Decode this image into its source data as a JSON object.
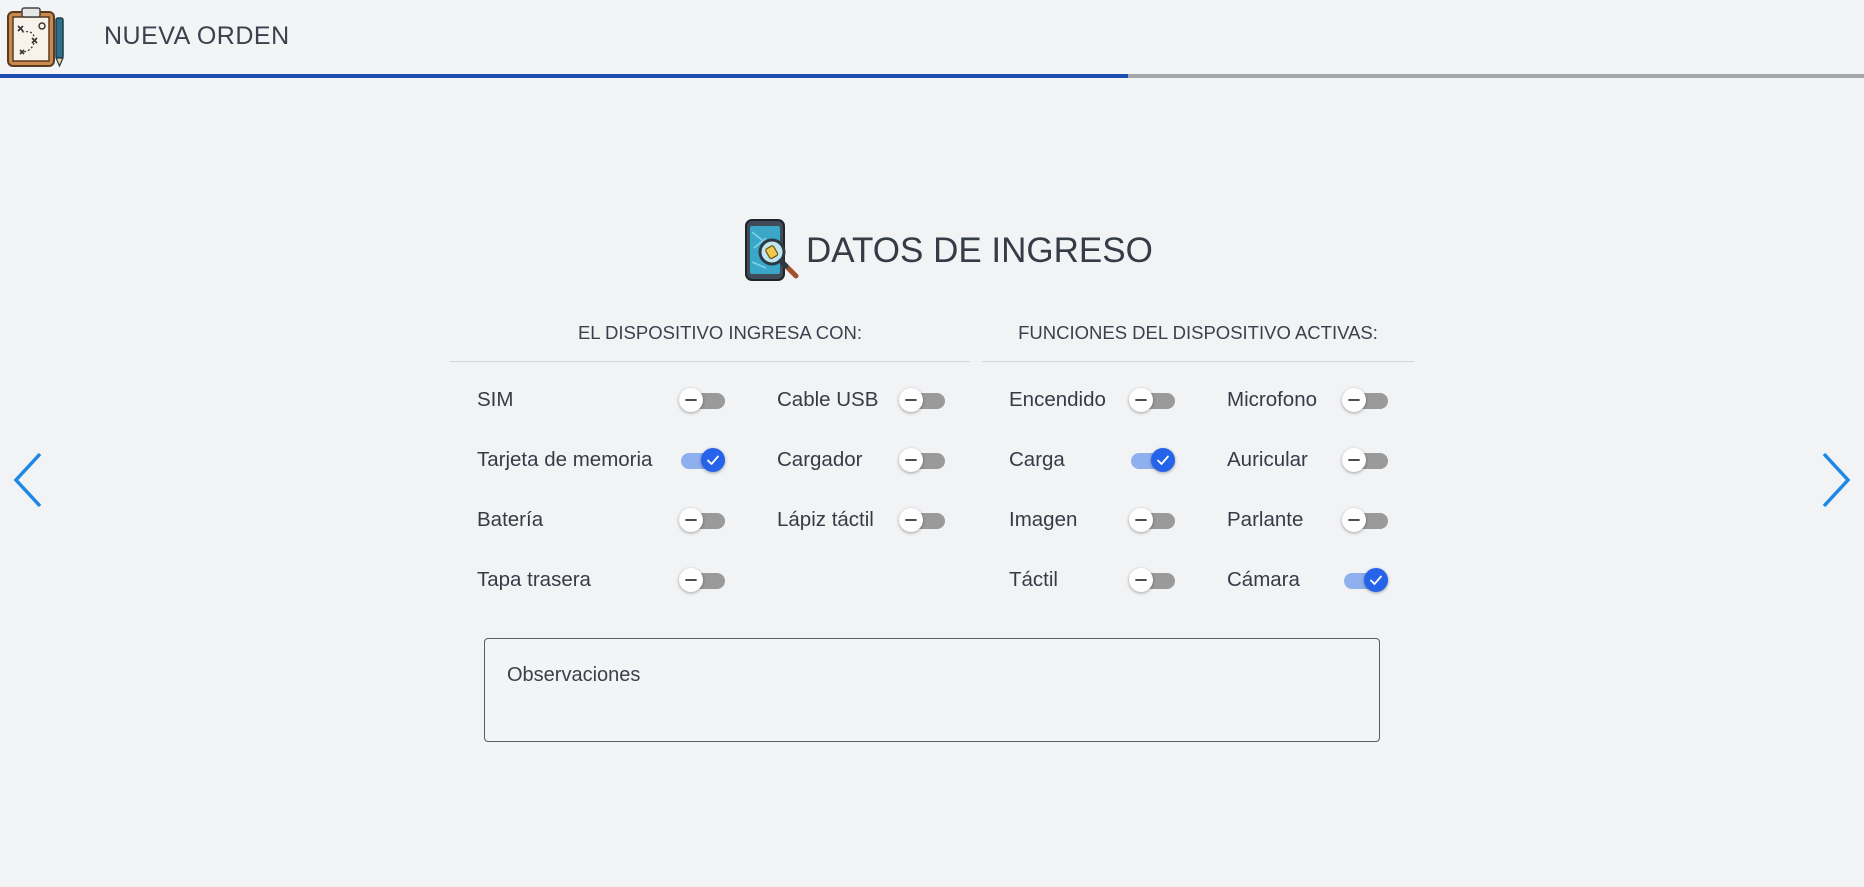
{
  "header": {
    "title": "NUEVA ORDEN",
    "progress": 0.605
  },
  "section": {
    "title": "DATOS DE INGRESO"
  },
  "groups": {
    "ingresa": {
      "header": "EL DISPOSITIVO INGRESA CON:",
      "items": [
        {
          "label": "SIM",
          "checked": false
        },
        {
          "label": "Cable USB",
          "checked": false
        },
        {
          "label": "Tarjeta de memoria",
          "checked": true
        },
        {
          "label": "Cargador",
          "checked": false
        },
        {
          "label": "Batería",
          "checked": false
        },
        {
          "label": "Lápiz táctil",
          "checked": false
        },
        {
          "label": "Tapa trasera",
          "checked": false
        }
      ]
    },
    "funciones": {
      "header": "FUNCIONES DEL DISPOSITIVO ACTIVAS:",
      "items": [
        {
          "label": "Encendido",
          "checked": false
        },
        {
          "label": "Microfono",
          "checked": false
        },
        {
          "label": "Carga",
          "checked": true
        },
        {
          "label": "Auricular",
          "checked": false
        },
        {
          "label": "Imagen",
          "checked": false
        },
        {
          "label": "Parlante",
          "checked": false
        },
        {
          "label": "Táctil",
          "checked": false
        },
        {
          "label": "Cámara",
          "checked": true
        }
      ]
    }
  },
  "observaciones": {
    "placeholder": "Observaciones",
    "value": ""
  },
  "colors": {
    "accent": "#2563eb",
    "progress": "#1d4fb0",
    "arrow": "#1e88e5"
  },
  "icons": {
    "logo": "clipboard-plan-icon",
    "section": "phone-magnifier-icon",
    "prev": "chevron-left-icon",
    "next": "chevron-right-icon",
    "toggle_off": "minus-icon",
    "toggle_on": "check-icon"
  }
}
